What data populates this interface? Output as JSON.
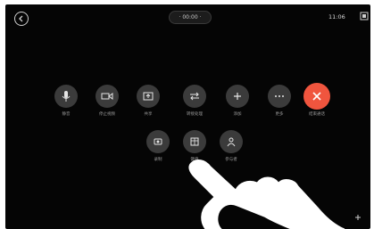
{
  "top_bar": {
    "duration": "· 00:00 ·",
    "clock": "11:06"
  },
  "controls_row1": [
    {
      "name": "mute-button",
      "icon": "microphone-icon",
      "label": "静音"
    },
    {
      "name": "stop-video-button",
      "icon": "video-icon",
      "label": "停止视频"
    },
    {
      "name": "share-button",
      "icon": "share-screen-icon",
      "label": "共享"
    },
    {
      "name": "transfer-button",
      "icon": "transfer-icon",
      "label": "转接处理"
    },
    {
      "name": "add-button",
      "icon": "plus-icon",
      "label": "添加"
    },
    {
      "name": "more-button",
      "icon": "more-icon",
      "label": "更多"
    },
    {
      "name": "end-call-button",
      "icon": "close-icon",
      "label": "结束通话",
      "color": "#f0553e"
    }
  ],
  "controls_row2": [
    {
      "name": "record-button",
      "icon": "record-icon",
      "label": "录制"
    },
    {
      "name": "keypad-button",
      "icon": "keypad-icon",
      "label": "键盘"
    },
    {
      "name": "participants-button",
      "icon": "person-icon",
      "label": "参与者"
    }
  ],
  "colors": {
    "background": "#050505",
    "button": "#3b3b3b",
    "end_call": "#f0553e"
  }
}
